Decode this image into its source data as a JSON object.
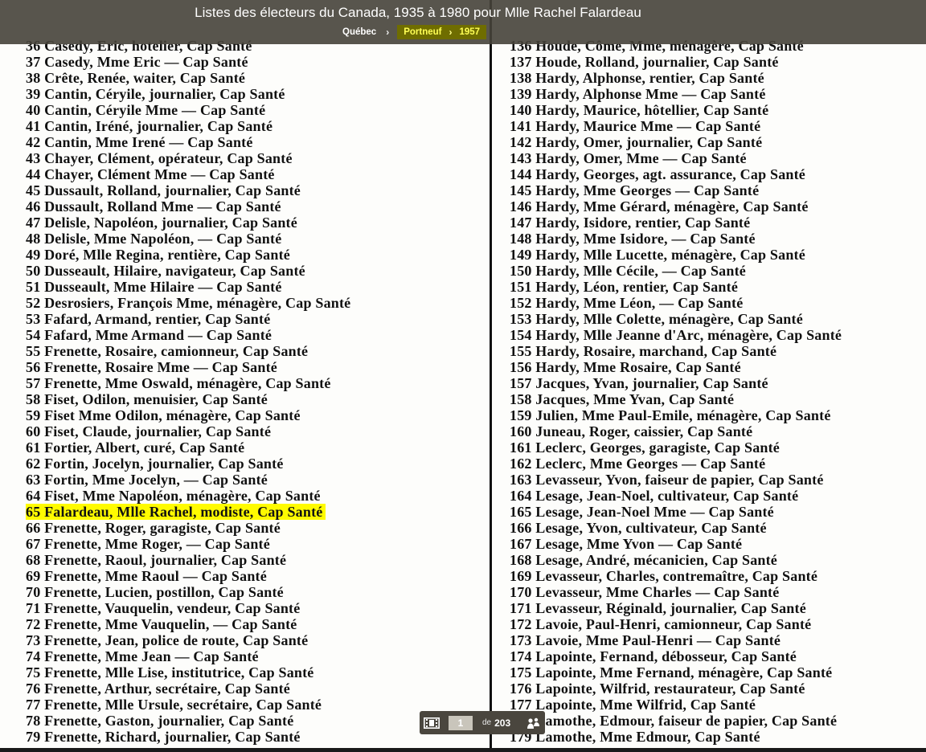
{
  "header": {
    "title": "Listes des électeurs du Canada, 1935 à 1980 pour Mlle Rachel Falardeau",
    "breadcrumb": [
      "Québec",
      "Portneuf",
      "1957"
    ]
  },
  "document": {
    "left_column": [
      "36 Casedy, Eric, hotelier, Cap Santé",
      "37 Casedy, Mme Eric — Cap Santé",
      "38 Crête, Renée, waiter, Cap Santé",
      "39 Cantin, Céryile, journalier, Cap Santé",
      "40 Cantin, Céryile Mme — Cap Santé",
      "41 Cantin, Iréné, journalier, Cap Santé",
      "42 Cantin, Mme Irené — Cap Santé",
      "43 Chayer, Clément, opérateur, Cap Santé",
      "44 Chayer, Clément Mme — Cap Santé",
      "45 Dussault, Rolland, journalier, Cap Santé",
      "46 Dussault, Rolland Mme — Cap Santé",
      "47 Delisle, Napoléon, journalier, Cap Santé",
      "48 Delisle, Mme Napoléon, — Cap Santé",
      "49 Doré, Mlle Regina, rentière, Cap Santé",
      "50 Dusseault, Hilaire, navigateur, Cap Santé",
      "51 Dusseault, Mme Hilaire — Cap Santé",
      "52 Desrosiers, François Mme, ménagère, Cap Santé",
      "53 Fafard, Armand, rentier, Cap Santé",
      "54 Fafard, Mme Armand — Cap Santé",
      "55 Frenette, Rosaire, camionneur, Cap Santé",
      "56 Frenette, Rosaire Mme — Cap Santé",
      "57 Frenette, Mme Oswald, ménagère, Cap Santé",
      "58 Fiset, Odilon, menuisier, Cap Santé",
      "59 Fiset Mme Odilon, ménagère, Cap Santé",
      "60 Fiset, Claude, journalier, Cap Santé",
      "61 Fortier, Albert, curé, Cap Santé",
      "62 Fortin, Jocelyn, journalier, Cap Santé",
      "63 Fortin, Mme Jocelyn, — Cap Santé",
      "64 Fiset, Mme Napoléon, ménagère, Cap Santé",
      "65 Falardeau, Mlle Rachel, modiste, Cap Santé",
      "66 Frenette, Roger, garagiste, Cap Santé",
      "67 Frenette, Mme Roger, — Cap Santé",
      "68 Frenette, Raoul, journalier, Cap Santé",
      "69 Frenette, Mme Raoul — Cap Santé",
      "70 Frenette, Lucien, postillon, Cap Santé",
      "71 Frenette, Vauquelin, vendeur, Cap Santé",
      "72 Frenette, Mme Vauquelin, — Cap Santé",
      "73 Frenette, Jean, police de route, Cap Santé",
      "74 Frenette, Mme Jean — Cap Santé",
      "75 Frenette, Mlle Lise, institutrice, Cap Santé",
      "76 Frenette, Arthur, secrétaire, Cap Santé",
      "77 Frenette, Mlle Ursule, secrétaire, Cap Santé",
      "78 Frenette, Gaston, journalier, Cap Santé",
      "79 Frenette, Richard, journalier, Cap Santé"
    ],
    "right_column": [
      "136 Houde, Côme, Mme, ménagère, Cap Santé",
      "137 Houde, Rolland, journalier, Cap Santé",
      "138 Hardy, Alphonse, rentier, Cap Santé",
      "139 Hardy, Alphonse Mme — Cap Santé",
      "140 Hardy, Maurice, hôtellier, Cap Santé",
      "141 Hardy, Maurice Mme — Cap Santé",
      "142 Hardy, Omer, journalier, Cap Santé",
      "143 Hardy, Omer, Mme — Cap Santé",
      "144 Hardy, Georges, agt. assurance, Cap Santé",
      "145 Hardy, Mme Georges — Cap Santé",
      "146 Hardy, Mme Gérard, ménagère, Cap Santé",
      "147 Hardy, Isidore, rentier, Cap Santé",
      "148 Hardy, Mme Isidore, — Cap Santé",
      "149 Hardy, Mlle Lucette, ménagère, Cap Santé",
      "150 Hardy, Mlle Cécile, — Cap Santé",
      "151 Hardy, Léon, rentier, Cap Santé",
      "152 Hardy, Mme Léon, — Cap Santé",
      "153 Hardy, Mlle Colette, ménagère, Cap Santé",
      "154 Hardy, Mlle Jeanne d'Arc, ménagère, Cap Santé",
      "155 Hardy, Rosaire, marchand, Cap Santé",
      "156 Hardy, Mme Rosaire, Cap Santé",
      "157 Jacques, Yvan, journalier, Cap Santé",
      "158 Jacques, Mme Yvan, Cap Santé",
      "159 Julien, Mme Paul-Emile, ménagère, Cap Santé",
      "160 Juneau, Roger, caissier, Cap Santé",
      "161 Leclerc, Georges, garagiste, Cap Santé",
      "162 Leclerc, Mme Georges — Cap Santé",
      "163 Levasseur, Yvon, faiseur de papier, Cap Santé",
      "164 Lesage, Jean-Noel, cultivateur, Cap Santé",
      "165 Lesage, Jean-Noel Mme — Cap Santé",
      "166 Lesage, Yvon, cultivateur, Cap Santé",
      "167 Lesage, Mme Yvon — Cap Santé",
      "168 Lesage, André, mécanicien, Cap Santé",
      "169 Levasseur, Charles, contremaître, Cap Santé",
      "170 Levasseur, Mme Charles — Cap Santé",
      "171 Levasseur, Réginald, journalier, Cap Santé",
      "172 Lavoie, Paul-Henri, camionneur, Cap Santé",
      "173 Lavoie, Mme Paul-Henri — Cap Santé",
      "174 Lapointe, Fernand, débosseur, Cap Santé",
      "175 Lapointe, Mme Fernand, ménagère, Cap Santé",
      "176 Lapointe, Wilfrid, restaurateur, Cap Santé",
      "177 Lapointe, Mme Wilfrid, Cap Santé",
      "178 Lamothe, Edmour, faiseur de papier, Cap Santé",
      "179 Lamothe, Mme Edmour, Cap Santé"
    ],
    "highlight_color": "#fffb00"
  },
  "pager": {
    "current_page": "1",
    "of_label": "de",
    "total_pages": "203"
  },
  "icons": {
    "filmstrip": "filmstrip-icon",
    "share": "share-icon"
  }
}
